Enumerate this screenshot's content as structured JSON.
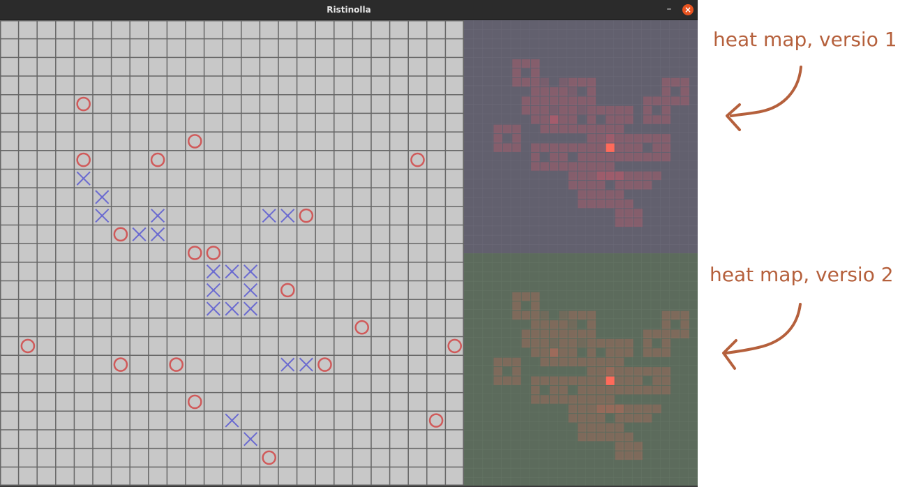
{
  "window": {
    "title": "Ristinolla",
    "minimize_symbol": "–",
    "close_symbol": "×"
  },
  "board": {
    "cols": 25,
    "rows": 25,
    "background": "#c8c8c8",
    "grid_color": "#666666",
    "o_color": "#d05a5a",
    "x_color": "#6a6ad0",
    "o_cells": [
      [
        4,
        4
      ],
      [
        10,
        6
      ],
      [
        4,
        7
      ],
      [
        8,
        7
      ],
      [
        22,
        7
      ],
      [
        16,
        10
      ],
      [
        6,
        11
      ],
      [
        10,
        12
      ],
      [
        11,
        12
      ],
      [
        15,
        14
      ],
      [
        19,
        16
      ],
      [
        1,
        17
      ],
      [
        24,
        17
      ],
      [
        6,
        18
      ],
      [
        9,
        18
      ],
      [
        17,
        18
      ],
      [
        10,
        20
      ],
      [
        23,
        21
      ],
      [
        14,
        23
      ]
    ],
    "x_cells": [
      [
        4,
        8
      ],
      [
        5,
        9
      ],
      [
        5,
        10
      ],
      [
        8,
        10
      ],
      [
        14,
        10
      ],
      [
        15,
        10
      ],
      [
        7,
        11
      ],
      [
        8,
        11
      ],
      [
        11,
        13
      ],
      [
        12,
        13
      ],
      [
        13,
        13
      ],
      [
        11,
        14
      ],
      [
        13,
        14
      ],
      [
        11,
        15
      ],
      [
        12,
        15
      ],
      [
        13,
        15
      ],
      [
        15,
        18
      ],
      [
        16,
        18
      ],
      [
        12,
        21
      ],
      [
        13,
        22
      ]
    ]
  },
  "heatmaps": [
    {
      "label": "heat map, versio 1",
      "background": "#62606e",
      "grid_color": "#6b6977",
      "cell_color": "#d05a6a"
    },
    {
      "label": "heat map, versio 2",
      "background": "#5c6b5c",
      "grid_color": "#657465",
      "cell_color": "#c86a5a"
    }
  ],
  "heat_cells": [
    [
      [
        2,
        1,
        2
      ],
      [
        3,
        1,
        2
      ],
      [
        4,
        1,
        2
      ],
      [
        2,
        2,
        2
      ],
      [
        4,
        2,
        2
      ],
      [
        2,
        3,
        2
      ],
      [
        3,
        3,
        2
      ],
      [
        4,
        3,
        2
      ],
      [
        5,
        3,
        1
      ],
      [
        7,
        3,
        1
      ],
      [
        8,
        3,
        2
      ],
      [
        9,
        3,
        2
      ],
      [
        10,
        3,
        2
      ],
      [
        7,
        4,
        2
      ],
      [
        8,
        4,
        1
      ],
      [
        10,
        4,
        2
      ],
      [
        7,
        5,
        2
      ],
      [
        8,
        5,
        2
      ],
      [
        9,
        5,
        2
      ],
      [
        10,
        5,
        2
      ],
      [
        4,
        4,
        2
      ],
      [
        5,
        4,
        2
      ],
      [
        6,
        4,
        2
      ],
      [
        3,
        5,
        2
      ],
      [
        4,
        5,
        2
      ],
      [
        5,
        5,
        2
      ],
      [
        6,
        5,
        2
      ],
      [
        3,
        6,
        2
      ],
      [
        4,
        6,
        2
      ],
      [
        5,
        6,
        2
      ],
      [
        6,
        6,
        1
      ],
      [
        7,
        6,
        2
      ],
      [
        8,
        6,
        2
      ],
      [
        9,
        6,
        1
      ],
      [
        4,
        7,
        2
      ],
      [
        5,
        7,
        2
      ],
      [
        6,
        7,
        3
      ],
      [
        7,
        7,
        2
      ],
      [
        8,
        7,
        2
      ],
      [
        10,
        6,
        2
      ],
      [
        11,
        6,
        2
      ],
      [
        12,
        6,
        2
      ],
      [
        13,
        6,
        2
      ],
      [
        14,
        6,
        2
      ],
      [
        10,
        7,
        2
      ],
      [
        12,
        7,
        2
      ],
      [
        13,
        7,
        2
      ],
      [
        14,
        7,
        2
      ],
      [
        5,
        8,
        2
      ],
      [
        6,
        8,
        2
      ],
      [
        7,
        8,
        2
      ],
      [
        8,
        8,
        2
      ],
      [
        9,
        8,
        2
      ],
      [
        10,
        8,
        2
      ],
      [
        11,
        8,
        2
      ],
      [
        12,
        8,
        2
      ],
      [
        13,
        8,
        2
      ],
      [
        12,
        9,
        2
      ],
      [
        13,
        9,
        2
      ],
      [
        14,
        9,
        2
      ],
      [
        10,
        9,
        2
      ],
      [
        11,
        9,
        2
      ],
      [
        12,
        9,
        2
      ],
      [
        10,
        10,
        2
      ],
      [
        11,
        10,
        2
      ],
      [
        12,
        10,
        5
      ],
      [
        13,
        10,
        2
      ],
      [
        14,
        10,
        2
      ],
      [
        10,
        11,
        2
      ],
      [
        11,
        11,
        2
      ],
      [
        12,
        11,
        2
      ],
      [
        13,
        11,
        2
      ],
      [
        14,
        11,
        2
      ],
      [
        10,
        12,
        2
      ],
      [
        11,
        12,
        2
      ],
      [
        12,
        12,
        2
      ],
      [
        11,
        13,
        2
      ],
      [
        12,
        13,
        2
      ],
      [
        13,
        13,
        2
      ],
      [
        18,
        3,
        2
      ],
      [
        19,
        3,
        2
      ],
      [
        20,
        3,
        2
      ],
      [
        21,
        3,
        2
      ],
      [
        18,
        4,
        2
      ],
      [
        20,
        4,
        2
      ],
      [
        21,
        4,
        2
      ],
      [
        18,
        5,
        2
      ],
      [
        19,
        5,
        2
      ],
      [
        20,
        5,
        2
      ],
      [
        21,
        5,
        2
      ],
      [
        16,
        5,
        2
      ],
      [
        17,
        5,
        2
      ],
      [
        16,
        6,
        2
      ],
      [
        18,
        6,
        2
      ],
      [
        16,
        7,
        2
      ],
      [
        17,
        7,
        2
      ],
      [
        18,
        7,
        2
      ],
      [
        0,
        8,
        2
      ],
      [
        1,
        8,
        2
      ],
      [
        2,
        8,
        2
      ],
      [
        0,
        9,
        2
      ],
      [
        2,
        9,
        2
      ],
      [
        0,
        10,
        2
      ],
      [
        1,
        10,
        2
      ],
      [
        2,
        10,
        2
      ],
      [
        24,
        8,
        2
      ],
      [
        25,
        8,
        2
      ],
      [
        24,
        9,
        2
      ],
      [
        24,
        10,
        2
      ],
      [
        25,
        10,
        2
      ],
      [
        15,
        9,
        2
      ],
      [
        16,
        9,
        2
      ],
      [
        17,
        9,
        2
      ],
      [
        18,
        9,
        2
      ],
      [
        15,
        10,
        2
      ],
      [
        17,
        10,
        2
      ],
      [
        18,
        10,
        2
      ],
      [
        15,
        11,
        2
      ],
      [
        16,
        11,
        2
      ],
      [
        17,
        11,
        2
      ],
      [
        18,
        11,
        2
      ],
      [
        4,
        10,
        2
      ],
      [
        5,
        10,
        2
      ],
      [
        6,
        10,
        2
      ],
      [
        7,
        10,
        2
      ],
      [
        8,
        10,
        2
      ],
      [
        9,
        10,
        2
      ],
      [
        4,
        11,
        2
      ],
      [
        6,
        11,
        2
      ],
      [
        7,
        11,
        2
      ],
      [
        9,
        11,
        2
      ],
      [
        4,
        12,
        2
      ],
      [
        5,
        12,
        2
      ],
      [
        6,
        12,
        2
      ],
      [
        7,
        12,
        2
      ],
      [
        8,
        12,
        2
      ],
      [
        9,
        12,
        2
      ],
      [
        8,
        13,
        2
      ],
      [
        9,
        13,
        2
      ],
      [
        10,
        13,
        2
      ],
      [
        11,
        13,
        2
      ],
      [
        12,
        13,
        2
      ],
      [
        13,
        13,
        2
      ],
      [
        14,
        13,
        2
      ],
      [
        15,
        13,
        2
      ],
      [
        16,
        13,
        2
      ],
      [
        17,
        13,
        2
      ],
      [
        13,
        14,
        2
      ],
      [
        14,
        14,
        2
      ],
      [
        15,
        14,
        2
      ],
      [
        16,
        14,
        2
      ],
      [
        8,
        14,
        2
      ],
      [
        9,
        14,
        2
      ],
      [
        10,
        14,
        2
      ],
      [
        11,
        14,
        2
      ],
      [
        11,
        15,
        2
      ],
      [
        12,
        15,
        2
      ],
      [
        13,
        15,
        2
      ],
      [
        22,
        12,
        2
      ],
      [
        23,
        12,
        2
      ],
      [
        24,
        12,
        2
      ],
      [
        22,
        13,
        2
      ],
      [
        24,
        13,
        2
      ],
      [
        22,
        14,
        2
      ],
      [
        23,
        14,
        2
      ],
      [
        24,
        14,
        2
      ],
      [
        9,
        15,
        2
      ],
      [
        10,
        15,
        2
      ],
      [
        9,
        16,
        2
      ],
      [
        10,
        16,
        2
      ],
      [
        11,
        16,
        2
      ],
      [
        12,
        16,
        2
      ],
      [
        13,
        16,
        2
      ],
      [
        14,
        16,
        2
      ],
      [
        13,
        17,
        2
      ],
      [
        14,
        17,
        2
      ],
      [
        15,
        17,
        2
      ],
      [
        13,
        18,
        2
      ],
      [
        14,
        18,
        2
      ],
      [
        15,
        18,
        2
      ]
    ]
  ],
  "annotations": [
    {
      "text": "heat map, versio 1"
    },
    {
      "text": "heat map, versio 2"
    }
  ]
}
